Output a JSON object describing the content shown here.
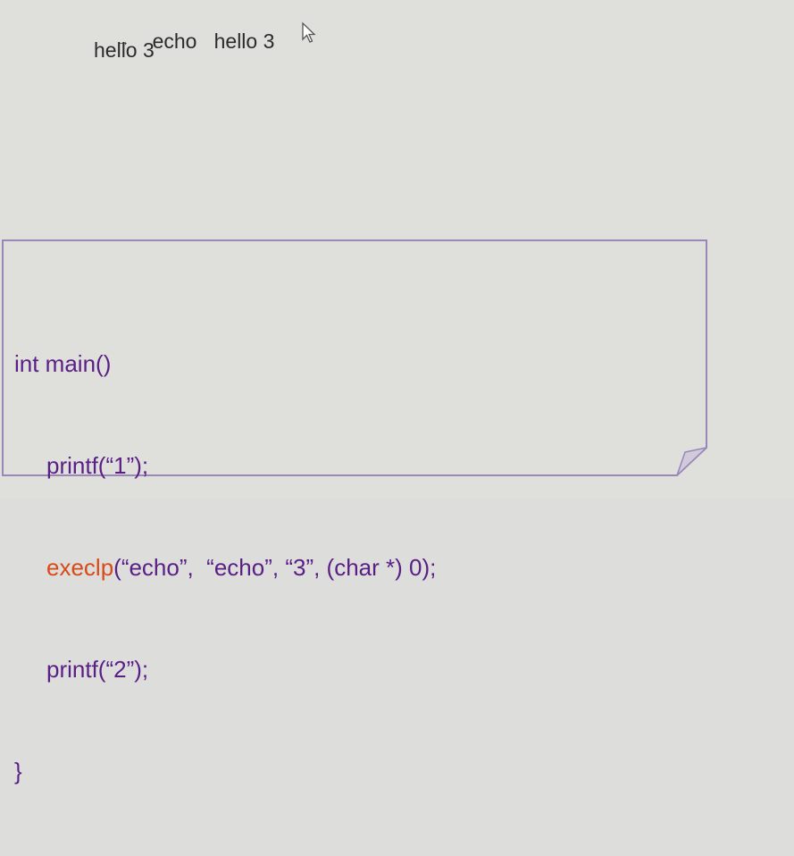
{
  "terminal": {
    "bullet": "→",
    "command": "echo",
    "argument": "hello 3",
    "output": "hello 3"
  },
  "code": {
    "line1": "int main()",
    "line2": "printf(“1”);",
    "line3_fn": "execlp",
    "line3_rest": "(“echo”,  “echo”, “3”, (char *) 0);",
    "line4": "printf(“2”);",
    "line5": "}"
  },
  "colors": {
    "background": "#dfdfdc",
    "code_text": "#5a1f86",
    "highlight": "#d84a18",
    "box_border": "#9a86b8"
  }
}
